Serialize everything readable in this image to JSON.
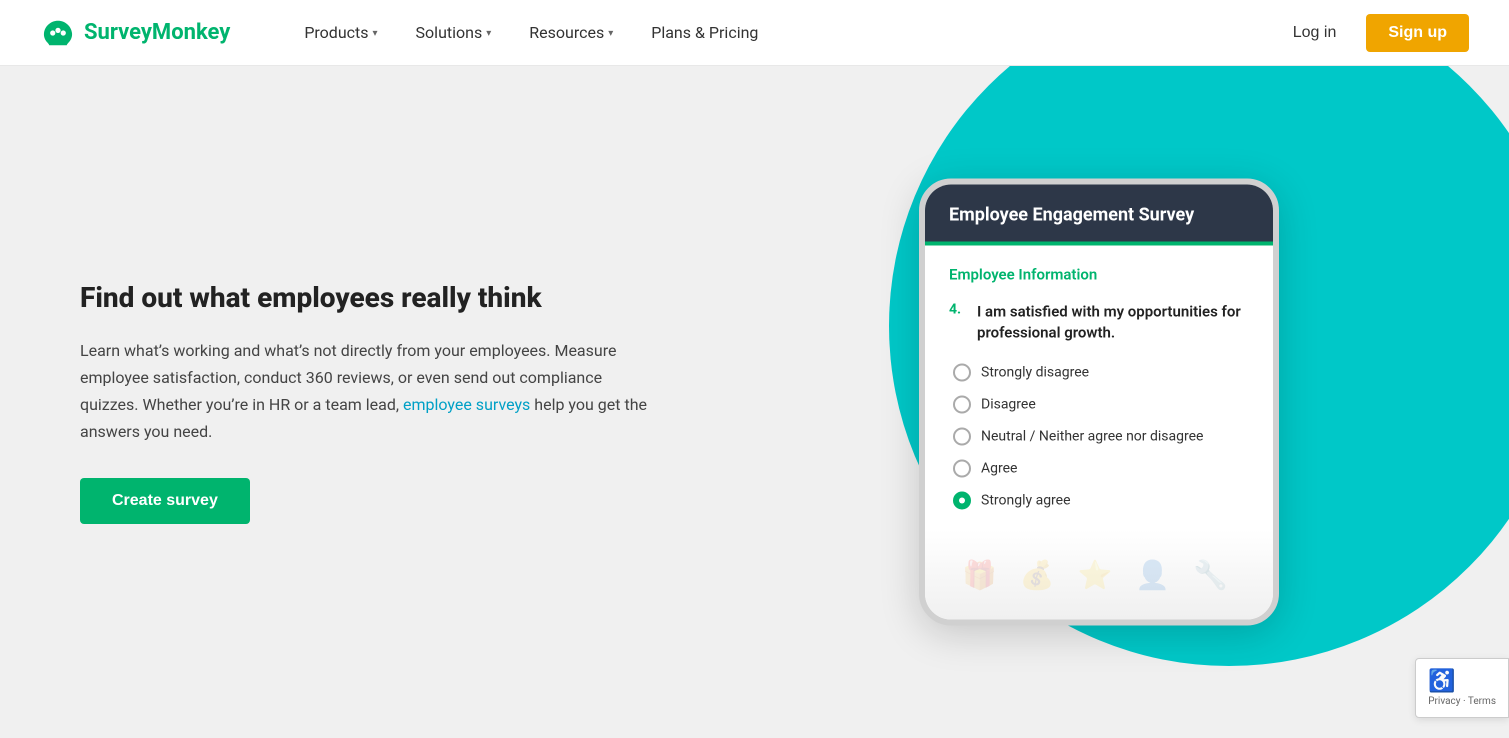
{
  "nav": {
    "logo_text": "SurveyMonkey",
    "items": [
      {
        "label": "Products",
        "has_chevron": true
      },
      {
        "label": "Solutions",
        "has_chevron": true
      },
      {
        "label": "Resources",
        "has_chevron": true
      },
      {
        "label": "Plans & Pricing",
        "has_chevron": false
      }
    ],
    "login_label": "Log in",
    "signup_label": "Sign up"
  },
  "hero": {
    "title": "Find out what employees really think",
    "description_1": "Learn what’s working and what’s not directly from your employees. Measure employee satisfaction, conduct 360 reviews, or even send out compliance quizzes. Whether you’re in HR or a team lead, ",
    "link_text": "employee surveys",
    "description_2": " help you get the answers you need.",
    "cta_label": "Create survey"
  },
  "survey_card": {
    "title": "Employee Engagement Survey",
    "section_label": "Employee Information",
    "question_number": "4.",
    "question_text": "I am satisfied with my opportunities for professional growth.",
    "options": [
      {
        "label": "Strongly disagree",
        "selected": false
      },
      {
        "label": "Disagree",
        "selected": false
      },
      {
        "label": "Neutral / Neither agree nor disagree",
        "selected": false
      },
      {
        "label": "Agree",
        "selected": false
      },
      {
        "label": "Strongly agree",
        "selected": true
      }
    ]
  },
  "recaptcha": {
    "line1": "Privacy • Terms",
    "icon": "♿"
  }
}
